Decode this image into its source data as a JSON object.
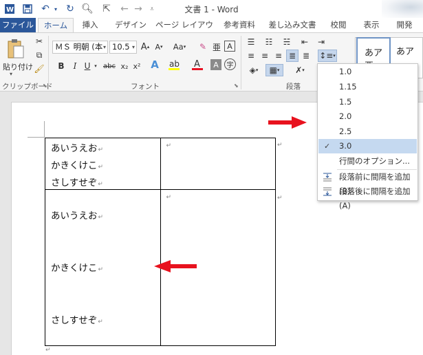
{
  "titlebar": {
    "title": "文書 1 - Word"
  },
  "tabs": [
    {
      "label": "ファイル"
    },
    {
      "label": "ホーム"
    },
    {
      "label": "挿入"
    },
    {
      "label": "デザイン"
    },
    {
      "label": "ページ レイアウト"
    },
    {
      "label": "参考資料"
    },
    {
      "label": "差し込み文書"
    },
    {
      "label": "校閲"
    },
    {
      "label": "表示"
    },
    {
      "label": "開発"
    }
  ],
  "ribbon": {
    "clipboard": {
      "paste_label": "貼り付け",
      "group_label": "クリップボード"
    },
    "font": {
      "font_name": "ＭＳ 明朝 (本",
      "font_size": "10.5",
      "grow_label": "A",
      "shrink_label": "A",
      "case_label": "Aa",
      "bold": "B",
      "italic": "I",
      "underline": "U",
      "strike": "abc",
      "subscript": "x₂",
      "superscript": "x²",
      "group_label": "フォント"
    },
    "paragraph": {
      "group_label": "段落"
    },
    "styles": {
      "style1": "あア亜",
      "style2": "あア"
    }
  },
  "spacing_menu": {
    "items": [
      {
        "label": "1.0",
        "checked": false
      },
      {
        "label": "1.15",
        "checked": false
      },
      {
        "label": "1.5",
        "checked": false
      },
      {
        "label": "2.0",
        "checked": false
      },
      {
        "label": "2.5",
        "checked": false
      },
      {
        "label": "3.0",
        "checked": true
      }
    ],
    "check_mark": "✓",
    "options_label": "行間のオプション...",
    "add_before_label": "段落前に間隔を追加(B)",
    "add_after_label": "段落後に間隔を追加(A)"
  },
  "document": {
    "paragraph_mark": "↵",
    "row1": {
      "cell1": [
        "あいうえお",
        "かきくけこ",
        "さしすせぞ"
      ]
    },
    "row2": {
      "cell1": [
        "あいうえお",
        "かきくけこ",
        "さしすせぞ"
      ]
    }
  },
  "colors": {
    "accent": "#2b579a",
    "arrow": "#e8121e",
    "menu_selected": "#c5d9f0"
  }
}
